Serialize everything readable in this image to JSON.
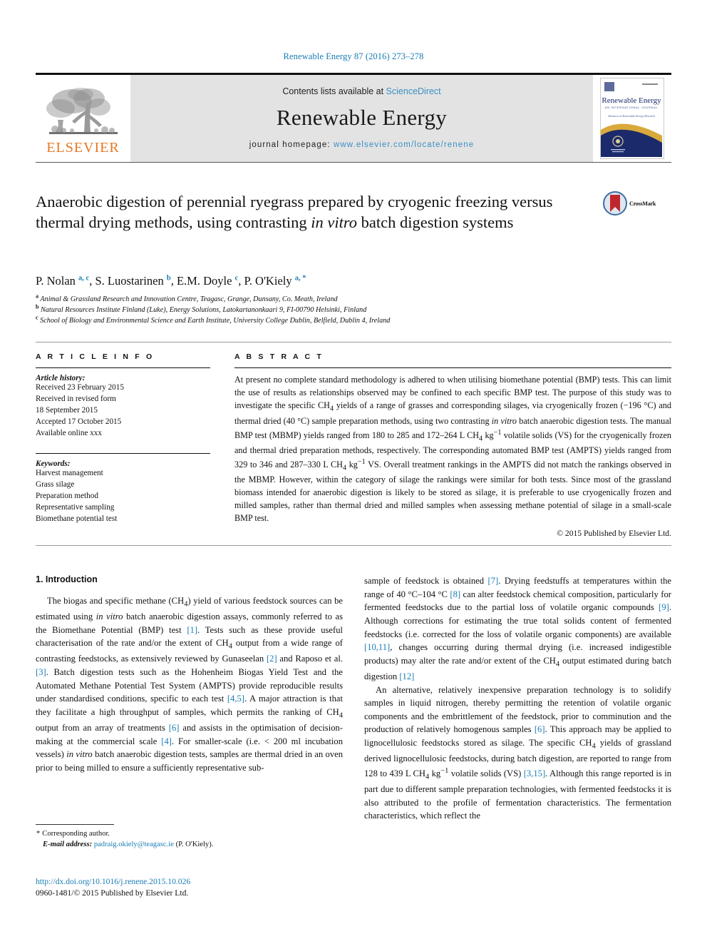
{
  "running_head": "Renewable Energy 87 (2016) 273–278",
  "masthead": {
    "publisher_name": "ELSEVIER",
    "contents_prefix": "Contents lists available at ",
    "contents_link": "ScienceDirect",
    "journal_title": "Renewable Energy",
    "homepage_prefix": "journal homepage: ",
    "homepage_url": "www.elsevier.com/locate/renene",
    "cover_title": "Renewable Energy",
    "cover_subtitle": "AN INTERNATIONAL JOURNAL",
    "cover_tagline": "Advances in Renewable Energy Research"
  },
  "article": {
    "title_part1": "Anaerobic digestion of perennial ryegrass prepared by cryogenic freezing versus thermal drying methods, using contrasting ",
    "title_italic": "in vitro",
    "title_part2": " batch digestion systems",
    "crossmark_label": "CrossMark",
    "authors": "P. Nolan a, c, S. Luostarinen b, E.M. Doyle c, P. O'Kiely a,*",
    "affiliations": [
      "Animal & Grassland Research and Innovation Centre, Teagasc, Grange, Dunsany, Co. Meath, Ireland",
      "Natural Resources Institute Finland (Luke), Energy Solutions, Latokartanonkaari 9, FI-00790 Helsinki, Finland",
      "School of Biology and Environmental Science and Earth Institute, University College Dublin, Belfield, Dublin 4, Ireland"
    ],
    "affiliation_marks": [
      "a",
      "b",
      "c"
    ]
  },
  "article_info": {
    "heading": "A R T I C L E   I N F O",
    "history_label": "Article history:",
    "history_lines": [
      "Received 23 February 2015",
      "Received in revised form",
      "18 September 2015",
      "Accepted 17 October 2015",
      "Available online xxx"
    ],
    "keywords_label": "Keywords:",
    "keywords": [
      "Harvest management",
      "Grass silage",
      "Preparation method",
      "Representative sampling",
      "Biomethane potential test"
    ]
  },
  "abstract": {
    "heading": "A B S T R A C T",
    "text_1": "At present no complete standard methodology is adhered to when utilising biomethane potential (BMP) tests. This can limit the use of results as relationships observed may be confined to each specific BMP test. The purpose of this study was to investigate the specific CH",
    "sub_4a": "4",
    "text_2": " yields of a range of grasses and corresponding silages, via cryogenically frozen (−196 °C) and thermal dried (40 °C) sample preparation methods, using two contrasting ",
    "italic_1": "in vitro",
    "text_3": " batch anaerobic digestion tests. The manual BMP test (MBMP) yields ranged from 180 to 285 and 172–264 L CH",
    "sub_4b": "4",
    "text_4": " kg",
    "sup_1": "−1",
    "text_5": " volatile solids (VS) for the cryogenically frozen and thermal dried preparation methods, respectively. The corresponding automated BMP test (AMPTS) yields ranged from 329 to 346 and 287–330 L CH",
    "sub_4c": "4",
    "text_6": " kg",
    "sup_2": "−1",
    "text_7": " VS. Overall treatment rankings in the AMPTS did not match the rankings observed in the MBMP. However, within the category of silage the rankings were similar for both tests. Since most of the grassland biomass intended for anaerobic digestion is likely to be stored as silage, it is preferable to use cryogenically frozen and milled samples, rather than thermal dried and milled samples when assessing methane potential of silage in a small-scale BMP test.",
    "copyright": "© 2015 Published by Elsevier Ltd."
  },
  "introduction": {
    "section_number_title": "1. Introduction",
    "left_p1_a": "The biogas and specific methane (CH",
    "left_p1_sub": "4",
    "left_p1_b": ") yield of various feedstock sources can be estimated using ",
    "left_p1_i1": "in vitro",
    "left_p1_c": " batch anaerobic digestion assays, commonly referred to as the Biomethane Potential (BMP) test ",
    "ref1": "[1]",
    "left_p1_d": ". Tests such as these provide useful characterisation of the rate and/or the extent of CH",
    "left_p1_sub2": "4",
    "left_p1_e": " output from a wide range of contrasting feedstocks, as extensively reviewed by Gunaseelan ",
    "ref2": "[2]",
    "left_p1_f": " and Raposo et al. ",
    "ref3": "[3]",
    "left_p1_g": ". Batch digestion tests such as the Hohenheim Biogas Yield Test and the Automated Methane Potential Test System (AMPTS) provide reproducible results under standardised conditions, specific to each test ",
    "ref45": "[4,5]",
    "left_p1_h": ". A major attraction is that they facilitate a high throughput of samples, which permits the ranking of CH",
    "left_p1_sub3": "4",
    "left_p1_i": " output from an array of treatments ",
    "ref6": "[6]",
    "left_p1_j": " and assists in the optimisation of decision-making at the commercial scale ",
    "ref4": "[4]",
    "left_p1_k": ". For smaller-scale (i.e. < 200 ml incubation vessels) ",
    "left_p1_i2": "in vitro",
    "left_p1_l": " batch anaerobic digestion tests, samples are thermal dried in an oven prior to being milled to ensure a sufficiently representative sub-",
    "right_p1_a": "sample of feedstock is obtained ",
    "ref7": "[7]",
    "right_p1_b": ". Drying feedstuffs at temperatures within the range of 40 °C–104 °C ",
    "ref8": "[8]",
    "right_p1_c": " can alter feedstock chemical composition, particularly for fermented feedstocks due to the partial loss of volatile organic compounds ",
    "ref9": "[9]",
    "right_p1_d": ". Although corrections for estimating the true total solids content of fermented feedstocks (i.e. corrected for the loss of volatile organic components) are available ",
    "ref1011": "[10,11]",
    "right_p1_e": ", changes occurring during thermal drying (i.e. increased indigestible products) may alter the rate and/or extent of the CH",
    "right_p1_sub": "4",
    "right_p1_f": " output estimated during batch digestion ",
    "ref12": "[12]",
    "right_p2_a": "An alternative, relatively inexpensive preparation technology is to solidify samples in liquid nitrogen, thereby permitting the retention of volatile organic components and the embrittlement of the feedstock, prior to comminution and the production of relatively homogenous samples ",
    "ref6b": "[6]",
    "right_p2_b": ". This approach may be applied to lignocellulosic feedstocks stored as silage. The specific CH",
    "right_p2_sub": "4",
    "right_p2_c": " yields of grassland derived lignocellulosic feedstocks, during batch digestion, are reported to range from 128 to 439 L CH",
    "right_p2_sub2": "4",
    "right_p2_d": " kg",
    "right_p2_sup": "−1",
    "right_p2_e": " volatile solids (VS) ",
    "ref315": "[3,15]",
    "right_p2_f": ". Although this range reported is in part due to different sample preparation technologies, with fermented feedstocks it is also attributed to the profile of fermentation characteristics. The fermentation characteristics, which reflect the"
  },
  "footnote": {
    "corresponding_author": "Corresponding author.",
    "email_label": "E-mail address:",
    "email": "padraig.okiely@teagasc.ie",
    "email_suffix": "(P. O'Kiely)."
  },
  "bottom": {
    "doi": "http://dx.doi.org/10.1016/j.renene.2015.10.026",
    "issn_line": "0960-1481/© 2015 Published by Elsevier Ltd."
  },
  "colors": {
    "link_blue": "#1a7cb5",
    "elsevier_orange": "#E87722",
    "masthead_gray": "#e3e3e3",
    "crossmark_red": "#c0272d",
    "crossmark_blue": "#3a6ea5"
  }
}
